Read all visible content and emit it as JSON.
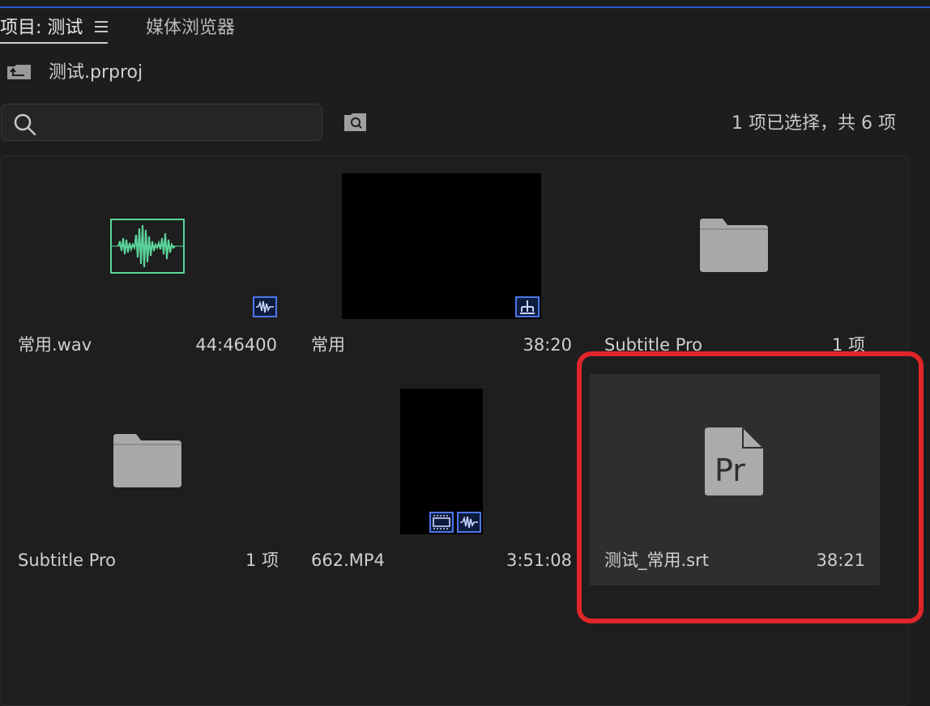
{
  "tabs": {
    "project": "项目: 测试",
    "media_browser": "媒体浏览器"
  },
  "project_file": "测试.prproj",
  "search": {
    "placeholder": "",
    "value": ""
  },
  "selection_count": "1 项已选择，共 6 项",
  "items": [
    {
      "name": "常用.wav",
      "meta": "44:46400",
      "type": "audio"
    },
    {
      "name": "常用",
      "meta": "38:20",
      "type": "sequence"
    },
    {
      "name": "Subtitle Pro",
      "meta": "1 项",
      "type": "bin"
    },
    {
      "name": "Subtitle Pro",
      "meta": "1 项",
      "type": "bin"
    },
    {
      "name": "662.MP4",
      "meta": "3:51:08",
      "type": "video"
    },
    {
      "name": "测试_常用.srt",
      "meta": "38:21",
      "type": "caption",
      "selected": true
    }
  ],
  "icons": {
    "menu": "hamburger-menu-icon",
    "back": "bin-up-icon",
    "search": "search-icon",
    "find_bin": "find-bin-icon",
    "audio": "audio-badge-icon",
    "sequence": "sequence-badge-icon",
    "video": "video-badge-icon",
    "file": "pr-file-icon"
  },
  "colors": {
    "accent": "#2d5bd6",
    "waveform": "#5bd49a",
    "highlight": "#e0262a",
    "badge_border": "#4d76e8"
  }
}
